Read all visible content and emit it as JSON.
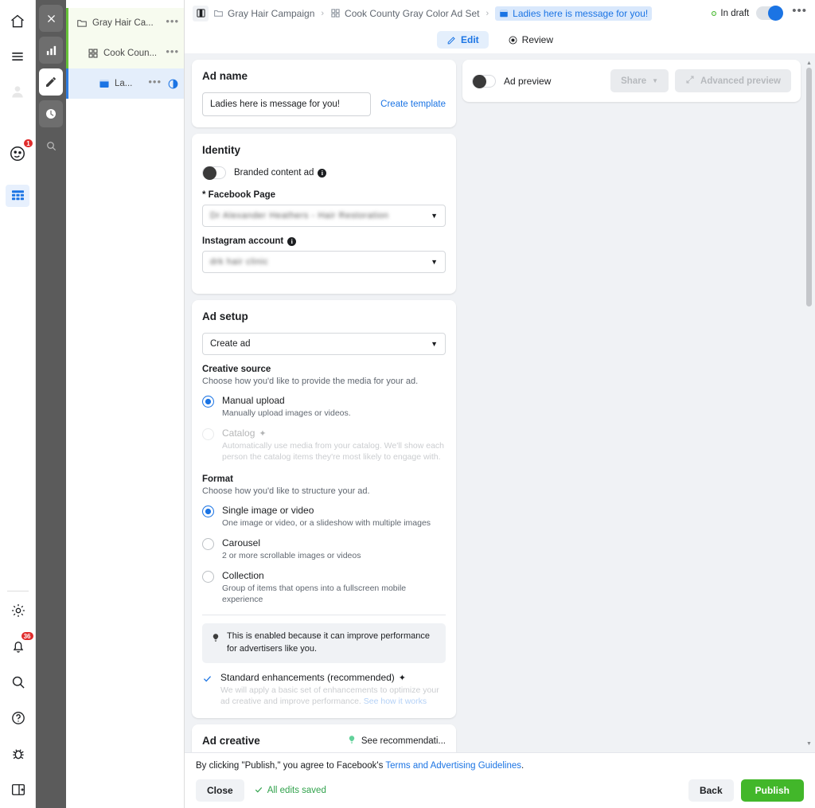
{
  "rail": {
    "top_icons": [
      {
        "name": "home-icon",
        "label": "Home"
      },
      {
        "name": "menu-icon",
        "label": "Menu"
      },
      {
        "name": "person-icon",
        "label": "Account"
      },
      {
        "name": "face-icon",
        "label": "Notifications",
        "badge": "1"
      },
      {
        "name": "table-icon",
        "label": "Table"
      }
    ],
    "bottom_icons": [
      {
        "name": "gear-icon",
        "label": "Settings"
      },
      {
        "name": "bell-icon",
        "label": "Alerts",
        "badge": "36"
      },
      {
        "name": "search-icon",
        "label": "Search"
      },
      {
        "name": "help-icon",
        "label": "Help"
      },
      {
        "name": "bug-icon",
        "label": "Report bug"
      },
      {
        "name": "panel-icon",
        "label": "Toggle panel"
      }
    ]
  },
  "toolstrip": {
    "items": [
      {
        "name": "close-icon",
        "label": "Close",
        "style": "dark"
      },
      {
        "name": "chart-icon",
        "label": "Charts",
        "style": "dark"
      },
      {
        "name": "pencil-icon",
        "label": "Edit",
        "style": "active"
      },
      {
        "name": "clock-icon",
        "label": "History",
        "style": "dark"
      },
      {
        "name": "search-icon",
        "label": "Search",
        "style": "plain"
      }
    ]
  },
  "tree": {
    "rows": [
      {
        "label": "Gray Hair Ca...",
        "icon": "folder-icon",
        "level": "campaign",
        "menu": "•••"
      },
      {
        "label": "Cook Coun...",
        "icon": "grid-icon",
        "level": "adset",
        "menu": "•••"
      },
      {
        "label": "La...",
        "icon": "ad-icon",
        "level": "ad",
        "menu": "•••",
        "contrast": "contrast-icon"
      }
    ]
  },
  "header": {
    "panel_toggle": "panel-toggle-icon",
    "breadcrumbs": [
      {
        "label": "Gray Hair Campaign",
        "icon": "folder-icon",
        "active": false
      },
      {
        "label": "Cook County Gray Color Ad Set",
        "icon": "grid-icon",
        "active": false
      },
      {
        "label": "Ladies here is message for you!",
        "icon": "ad-icon",
        "active": true
      }
    ],
    "separator": "›",
    "status": "In draft",
    "status_color": "#42b72a",
    "more_menu": "•••"
  },
  "tabs": [
    {
      "label": "Edit",
      "icon": "pencil-icon",
      "selected": true
    },
    {
      "label": "Review",
      "icon": "eye-icon",
      "selected": false
    }
  ],
  "ad_name": {
    "title": "Ad name",
    "value": "Ladies here is message for you!",
    "placeholder": "Ad name",
    "create_template": "Create template"
  },
  "identity": {
    "title": "Identity",
    "branded_content_label": "Branded content ad",
    "branded_content_on": false,
    "facebook_page_label": "* Facebook Page",
    "facebook_page_value": "Dr Alexander Heathers - Hair Restoration",
    "instagram_label": "Instagram account",
    "instagram_value": "drk hair clinic"
  },
  "ad_setup": {
    "title": "Ad setup",
    "select_value": "Create ad",
    "creative_source": {
      "heading": "Creative source",
      "description": "Choose how you'd like to provide the media for your ad.",
      "options": [
        {
          "label": "Manual upload",
          "desc": "Manually upload images or videos.",
          "selected": true,
          "disabled": false,
          "sparkle": false
        },
        {
          "label": "Catalog",
          "desc": "Automatically use media from your catalog. We'll show each person the catalog items they're most likely to engage with.",
          "selected": false,
          "disabled": true,
          "sparkle": true
        }
      ]
    },
    "format": {
      "heading": "Format",
      "description": "Choose how you'd like to structure your ad.",
      "options": [
        {
          "label": "Single image or video",
          "desc": "One image or video, or a slideshow with multiple images",
          "selected": true
        },
        {
          "label": "Carousel",
          "desc": "2 or more scrollable images or videos",
          "selected": false
        },
        {
          "label": "Collection",
          "desc": "Group of items that opens into a fullscreen mobile experience",
          "selected": false
        }
      ]
    },
    "tip": "This is enabled because it can improve performance for advertisers like you.",
    "enhancement": {
      "label": "Standard enhancements (recommended)",
      "checked": true,
      "sparkle": true,
      "desc": "We will apply a basic set of enhancements to optimize your ad creative and improve performance.",
      "link": "See how it works"
    }
  },
  "ad_creative": {
    "title": "Ad creative",
    "recommendations": "See recommendati..."
  },
  "preview": {
    "label": "Ad preview",
    "toggle_on": false,
    "share_button": "Share",
    "advanced_button": "Advanced preview"
  },
  "footer": {
    "legal_prefix": "By clicking \"Publish,\" you agree to Facebook's ",
    "legal_link": "Terms and Advertising Guidelines",
    "legal_suffix": ".",
    "close": "Close",
    "saved": "All edits saved",
    "back": "Back",
    "publish": "Publish",
    "publish_color": "#42b72a"
  }
}
